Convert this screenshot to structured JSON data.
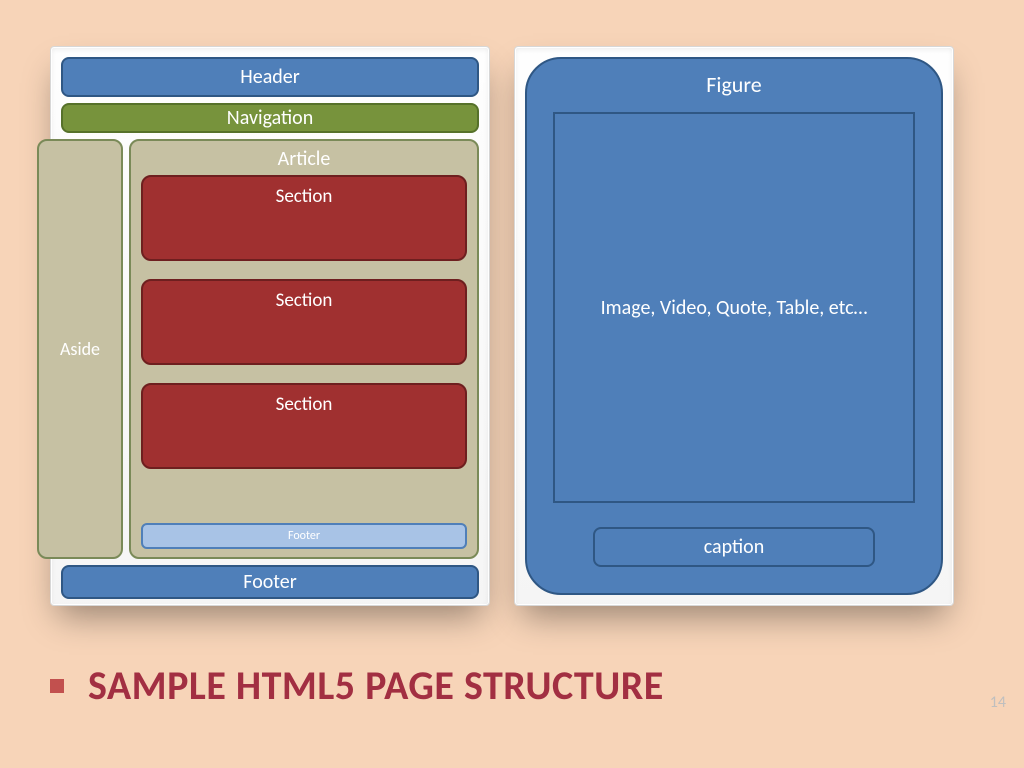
{
  "left": {
    "header": "Header",
    "navigation": "Navigation",
    "aside": "Aside",
    "article": {
      "title": "Article",
      "sections": [
        "Section",
        "Section",
        "Section"
      ],
      "footer": "Footer"
    },
    "footer": "Footer"
  },
  "right": {
    "figure_title": "Figure",
    "media_text": "Image, Video, Quote, Table, etc…",
    "caption": "caption"
  },
  "headline": "SAMPLE HTML5 PAGE STRUCTURE",
  "page_number": "14",
  "colors": {
    "background": "#f7d4b8",
    "blue": "#4f7fb9",
    "blue_border": "#2f5784",
    "olive": "#77933c",
    "tan": "#c6c1a3",
    "red": "#a03030",
    "light_blue": "#a8c3e6",
    "accent": "#a22f42"
  }
}
